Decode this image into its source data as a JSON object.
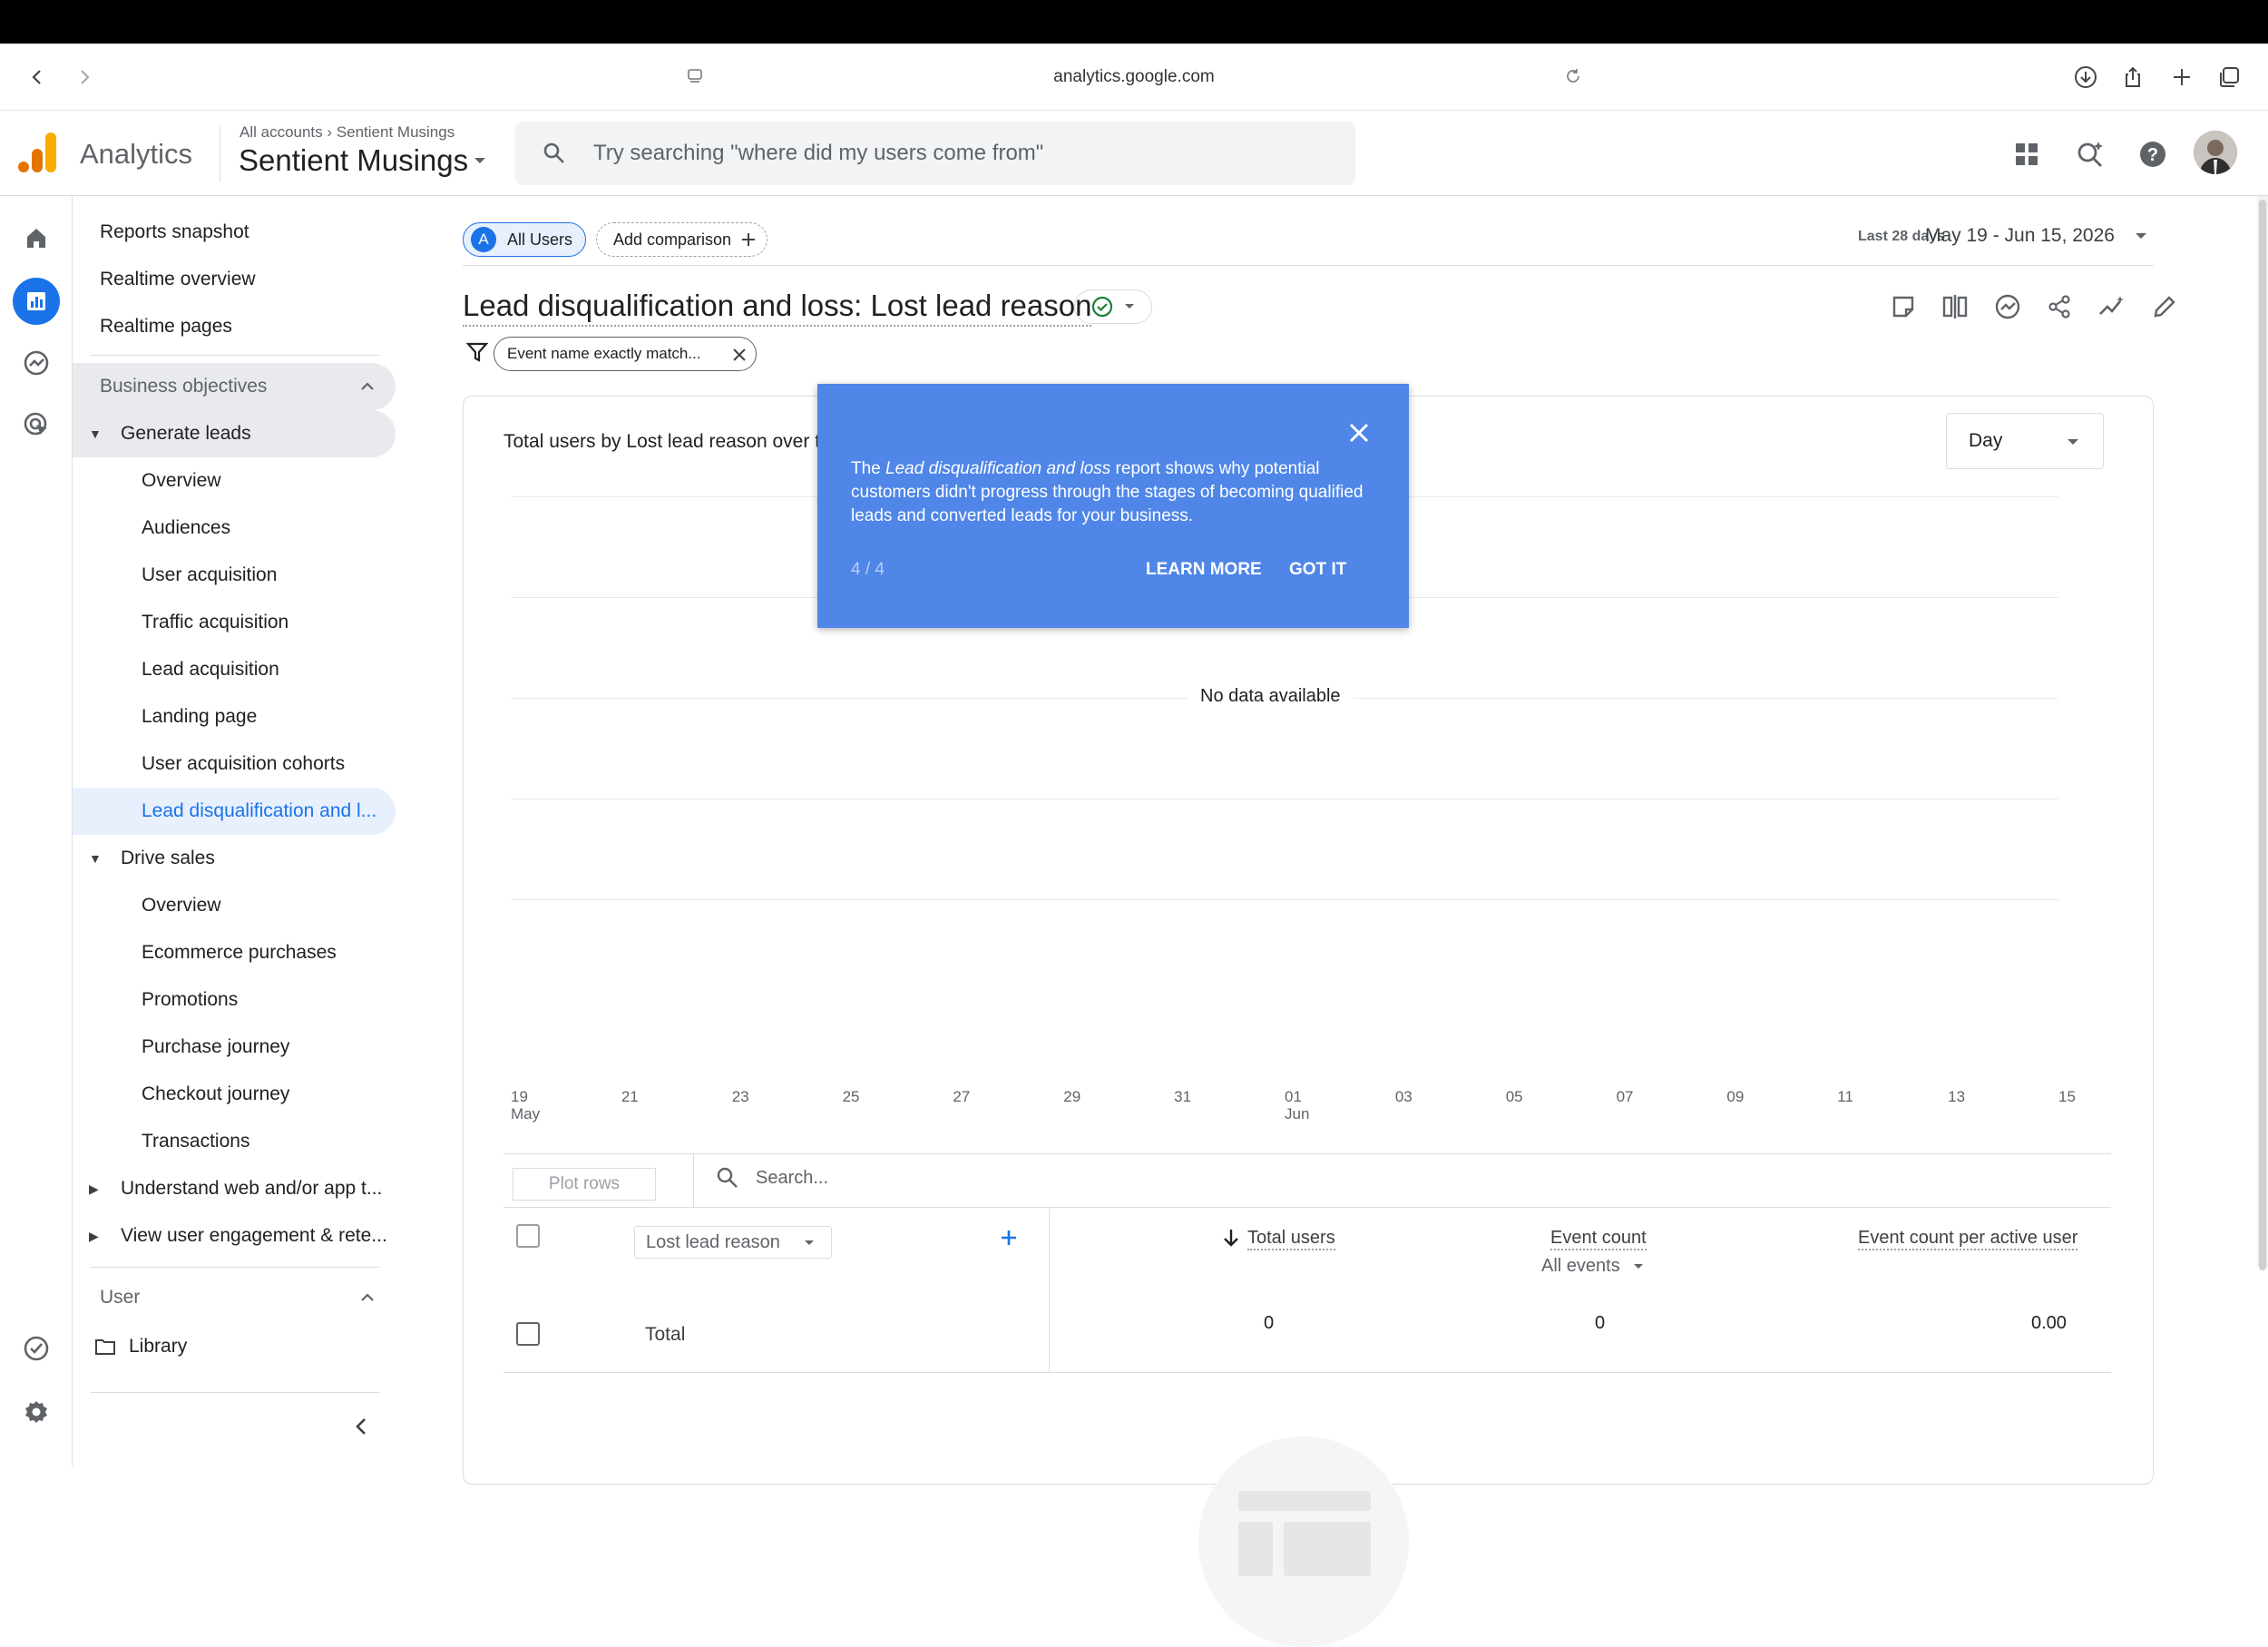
{
  "browser": {
    "url": "analytics.google.com"
  },
  "header": {
    "app_name": "Analytics",
    "breadcrumb_root": "All accounts",
    "breadcrumb_sep": "›",
    "breadcrumb_leaf": "Sentient Musings",
    "account_name": "Sentient Musings",
    "search_placeholder": "Try searching \"where did my users come from\""
  },
  "nav": {
    "top_items": [
      "Reports snapshot",
      "Realtime overview",
      "Realtime pages"
    ],
    "section_business": "Business objectives",
    "generate_leads": "Generate leads",
    "generate_leads_items": [
      "Overview",
      "Audiences",
      "User acquisition",
      "Traffic acquisition",
      "Lead acquisition",
      "Landing page",
      "User acquisition cohorts",
      "Lead disqualification and l..."
    ],
    "drive_sales": "Drive sales",
    "drive_sales_items": [
      "Overview",
      "Ecommerce purchases",
      "Promotions",
      "Purchase journey",
      "Checkout journey",
      "Transactions"
    ],
    "understand": "Understand web and/or app t...",
    "engagement": "View user engagement & rete...",
    "section_user": "User",
    "library": "Library"
  },
  "toolbar": {
    "segment_letter": "A",
    "segment": "All Users",
    "add_comparison": "Add comparison",
    "date_label": "Last 28 days",
    "date_range": "May 19 - Jun 15, 2026"
  },
  "report": {
    "title": "Lead disqualification and loss: Lost lead reason",
    "filter_chip": "Event name exactly match..."
  },
  "chart_data": {
    "type": "line",
    "title": "Total users by Lost lead reason over t",
    "granularity": "Day",
    "x_ticks": [
      {
        "day": "19",
        "month": "May"
      },
      {
        "day": "21",
        "month": ""
      },
      {
        "day": "23",
        "month": ""
      },
      {
        "day": "25",
        "month": ""
      },
      {
        "day": "27",
        "month": ""
      },
      {
        "day": "29",
        "month": ""
      },
      {
        "day": "31",
        "month": ""
      },
      {
        "day": "01",
        "month": "Jun"
      },
      {
        "day": "03",
        "month": ""
      },
      {
        "day": "05",
        "month": ""
      },
      {
        "day": "07",
        "month": ""
      },
      {
        "day": "09",
        "month": ""
      },
      {
        "day": "11",
        "month": ""
      },
      {
        "day": "13",
        "month": ""
      },
      {
        "day": "15",
        "month": ""
      }
    ],
    "series": [],
    "empty_message": "No data available",
    "grid": true
  },
  "tooltip": {
    "text_pre": "The ",
    "text_em": "Lead disqualification and loss",
    "text_post": " report shows why potential customers didn't progress through the stages of becoming qualified leads and converted leads for your business.",
    "step": "4 / 4",
    "learn_more": "LEARN MORE",
    "got_it": "GOT IT"
  },
  "table": {
    "plot_rows": "Plot rows",
    "search_placeholder": "Search...",
    "dimension": "Lost lead reason",
    "col_total_users": "Total users",
    "col_event_count": "Event count",
    "col_event_count_sub": "All events",
    "col_per_user": "Event count per active user",
    "total_label": "Total",
    "total_users": "0",
    "total_events": "0",
    "total_per_user": "0.00"
  }
}
